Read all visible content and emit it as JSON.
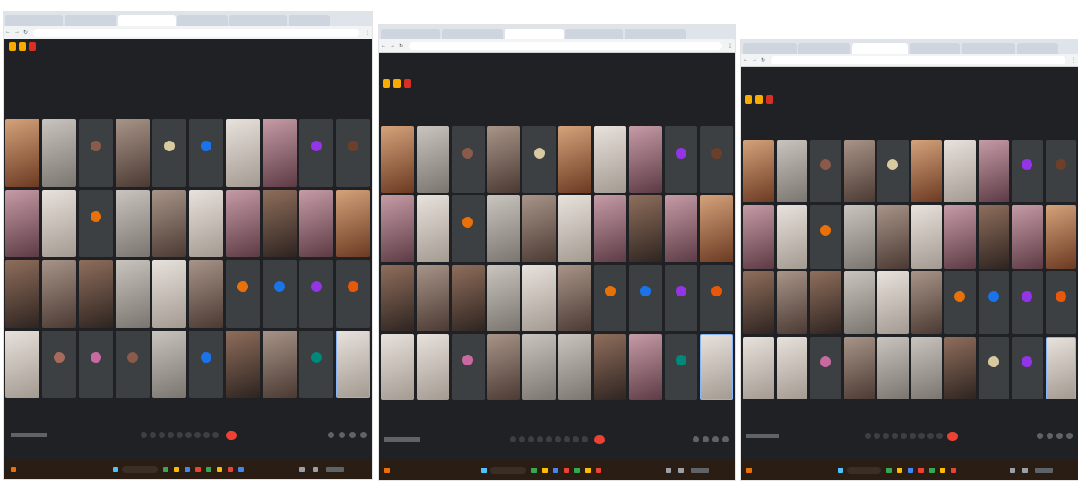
{
  "screenshots": [
    {
      "id": 1,
      "tabs": [
        "",
        "",
        "",
        "",
        "",
        ""
      ],
      "url": "",
      "meeting_code": ""
    },
    {
      "id": 2,
      "tabs": [
        "",
        "",
        "",
        "",
        ""
      ],
      "url": "",
      "meeting_code": ""
    },
    {
      "id": 3,
      "tabs": [
        "",
        "",
        "",
        "",
        "",
        ""
      ],
      "url": "",
      "meeting_code": ""
    }
  ],
  "icons": {
    "back": "←",
    "forward": "→",
    "reload": "↻",
    "close": "✕",
    "menu": "⋮"
  },
  "colors": {
    "meet_background": "#202124",
    "tile_background": "#3c4043",
    "hangup": "#ea4335",
    "selected_tile_border": "#8ab4f8",
    "top_icon_yellow": "#f9ab00",
    "top_icon_red": "#d93025",
    "avatar_orange": "#e8710a",
    "avatar_blue": "#1a73e8",
    "avatar_purple": "#9334e6",
    "avatar_teal": "#00897b",
    "taskbar": "#2a1d14"
  },
  "participant_grid": {
    "columns": 10,
    "rows": 4
  }
}
